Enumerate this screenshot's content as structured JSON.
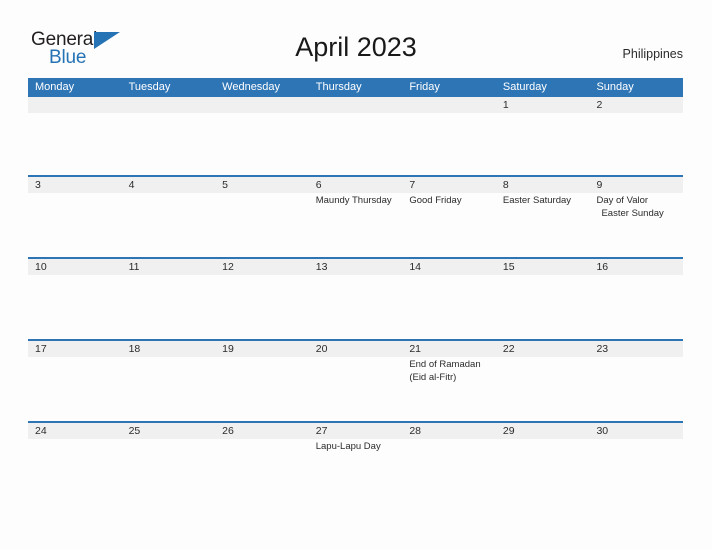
{
  "brand": {
    "name_part1": "General",
    "name_part2": "Blue",
    "triangle_icon": "blue-triangle-logo-mark",
    "accent_color": "#2573b5"
  },
  "header": {
    "title": "April 2023",
    "country": "Philippines"
  },
  "colors": {
    "header_blue": "#2e75b6",
    "date_band_gray": "#f0f0f0",
    "page_background": "#fdfdfd",
    "text": "#2b2b2b"
  },
  "calendar": {
    "month": "April",
    "year": "2023",
    "day_headers": [
      "Monday",
      "Tuesday",
      "Wednesday",
      "Thursday",
      "Friday",
      "Saturday",
      "Sunday"
    ],
    "weeks": [
      {
        "days": [
          {
            "num": "",
            "events": []
          },
          {
            "num": "",
            "events": []
          },
          {
            "num": "",
            "events": []
          },
          {
            "num": "",
            "events": []
          },
          {
            "num": "",
            "events": []
          },
          {
            "num": "1",
            "events": []
          },
          {
            "num": "2",
            "events": []
          }
        ]
      },
      {
        "days": [
          {
            "num": "3",
            "events": []
          },
          {
            "num": "4",
            "events": []
          },
          {
            "num": "5",
            "events": []
          },
          {
            "num": "6",
            "events": [
              {
                "text": "Maundy Thursday",
                "indent": false
              }
            ]
          },
          {
            "num": "7",
            "events": [
              {
                "text": "Good Friday",
                "indent": false
              }
            ]
          },
          {
            "num": "8",
            "events": [
              {
                "text": "Easter Saturday",
                "indent": false
              }
            ]
          },
          {
            "num": "9",
            "events": [
              {
                "text": "Day of Valor",
                "indent": false
              },
              {
                "text": "Easter Sunday",
                "indent": true
              }
            ]
          }
        ]
      },
      {
        "days": [
          {
            "num": "10",
            "events": []
          },
          {
            "num": "11",
            "events": []
          },
          {
            "num": "12",
            "events": []
          },
          {
            "num": "13",
            "events": []
          },
          {
            "num": "14",
            "events": []
          },
          {
            "num": "15",
            "events": []
          },
          {
            "num": "16",
            "events": []
          }
        ]
      },
      {
        "days": [
          {
            "num": "17",
            "events": []
          },
          {
            "num": "18",
            "events": []
          },
          {
            "num": "19",
            "events": []
          },
          {
            "num": "20",
            "events": []
          },
          {
            "num": "21",
            "events": [
              {
                "text": "End of Ramadan",
                "indent": false
              },
              {
                "text": "(Eid al-Fitr)",
                "indent": false
              }
            ]
          },
          {
            "num": "22",
            "events": []
          },
          {
            "num": "23",
            "events": []
          }
        ]
      },
      {
        "days": [
          {
            "num": "24",
            "events": []
          },
          {
            "num": "25",
            "events": []
          },
          {
            "num": "26",
            "events": []
          },
          {
            "num": "27",
            "events": [
              {
                "text": "Lapu-Lapu Day",
                "indent": false
              }
            ]
          },
          {
            "num": "28",
            "events": []
          },
          {
            "num": "29",
            "events": []
          },
          {
            "num": "30",
            "events": []
          }
        ]
      }
    ]
  }
}
